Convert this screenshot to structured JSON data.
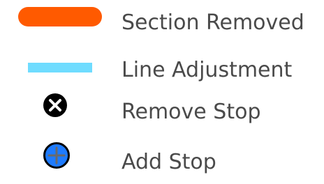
{
  "legend": {
    "items": [
      {
        "label": "Section Removed",
        "symbol": "orange-line-icon",
        "color": "#ff5a00"
      },
      {
        "label": "Line Adjustment",
        "symbol": "light-blue-line-icon",
        "color": "#6fdcff"
      },
      {
        "label": "Remove Stop",
        "symbol": "remove-stop-icon",
        "color": "#000000"
      },
      {
        "label": "Add Stop",
        "symbol": "add-stop-icon",
        "color": "#1e7bff"
      }
    ]
  }
}
